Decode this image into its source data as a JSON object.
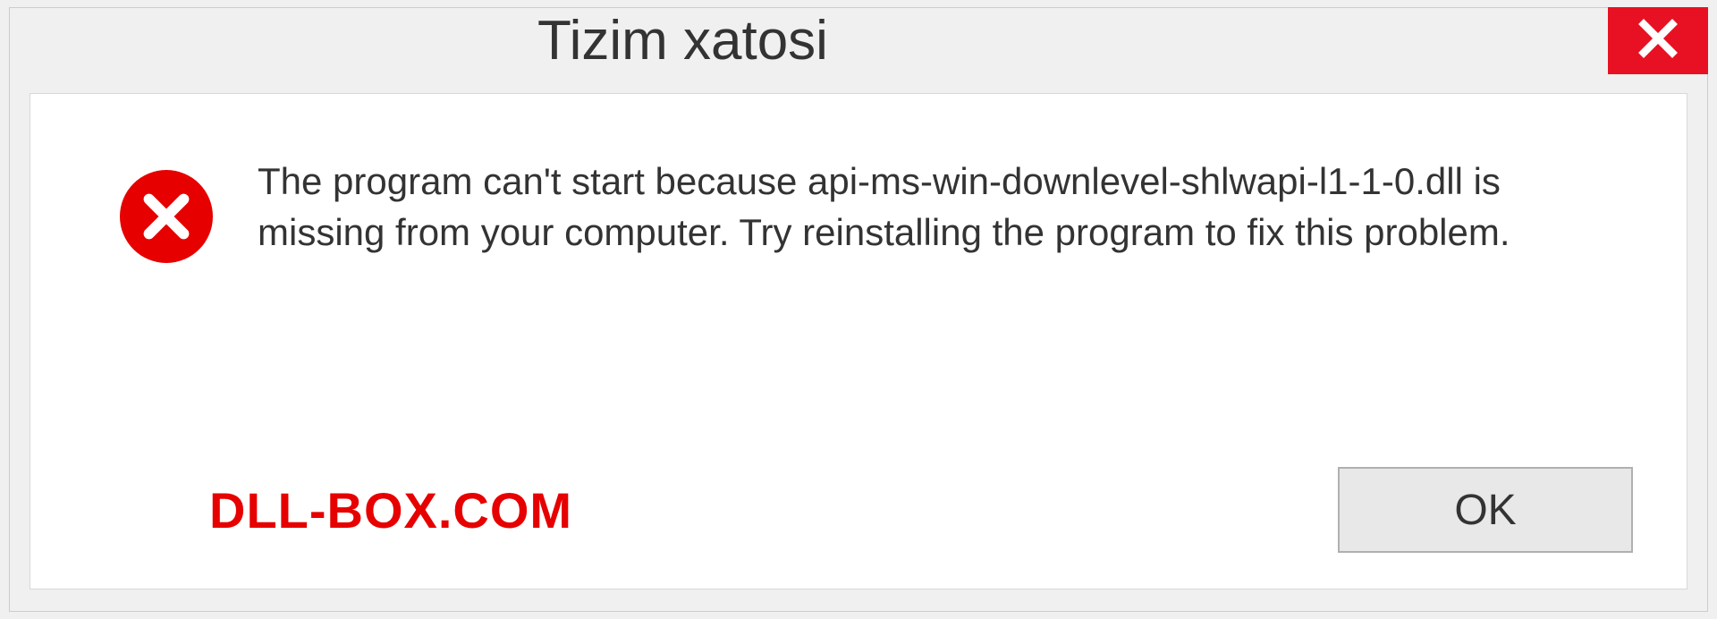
{
  "dialog": {
    "title": "Tizim xatosi",
    "message": "The program can't start because api-ms-win-downlevel-shlwapi-l1-1-0.dll is missing from your computer. Try reinstalling the program to fix this problem.",
    "ok_label": "OK"
  },
  "watermark": "DLL-BOX.COM",
  "icons": {
    "close": "close-icon",
    "error": "error-icon"
  },
  "colors": {
    "close_bg": "#e81123",
    "error_bg": "#e60000",
    "watermark": "#e60000"
  }
}
